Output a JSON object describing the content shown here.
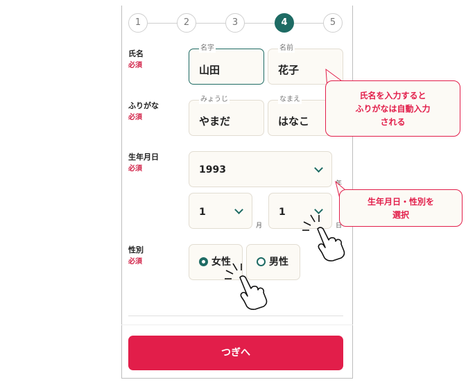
{
  "stepper": {
    "steps": [
      "1",
      "2",
      "3",
      "4",
      "5"
    ],
    "current": "4"
  },
  "required_label": "必須",
  "name": {
    "label": "氏名",
    "last": {
      "tag": "名字",
      "value": "山田"
    },
    "first": {
      "tag": "名前",
      "value": "花子"
    }
  },
  "kana": {
    "label": "ふりがな",
    "last": {
      "tag": "みょうじ",
      "value": "やまだ"
    },
    "first": {
      "tag": "なまえ",
      "value": "はなこ"
    }
  },
  "birth": {
    "label": "生年月日",
    "year": "1993",
    "year_unit": "年",
    "month": "1",
    "month_unit": "月",
    "day": "1",
    "day_unit": "日"
  },
  "gender": {
    "label": "性別",
    "options": [
      {
        "label": "女性",
        "selected": true
      },
      {
        "label": "男性",
        "selected": false
      }
    ]
  },
  "next_button": "つぎへ",
  "callouts": {
    "name": [
      "氏名を入力すると",
      "ふりがなは自動入力",
      "される"
    ],
    "birth": [
      "生年月日・性別を",
      "選択"
    ]
  },
  "colors": {
    "accent": "#1e6b64",
    "primary": "#e21e4a",
    "field_bg": "#fcfaf5"
  },
  "icons": [
    "chevron-down-icon",
    "pointing-hand-icon",
    "radio-icon"
  ]
}
